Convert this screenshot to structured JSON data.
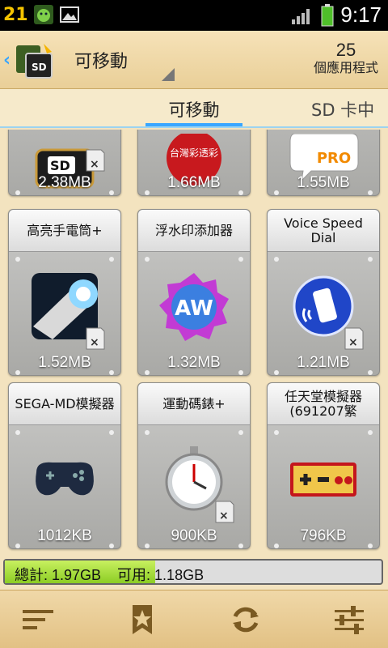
{
  "status_bar": {
    "notification_count": "21",
    "time": "9:17"
  },
  "action_bar": {
    "title": "可移動",
    "app_count": "25",
    "app_count_label": "個應用程式"
  },
  "tabs": [
    {
      "label": "可移動",
      "active": true
    },
    {
      "label": "SD 卡中",
      "active": false
    }
  ],
  "apps": [
    {
      "name": "",
      "size": "2.38MB",
      "icon": "sd-card-app-icon"
    },
    {
      "name": "",
      "size": "1.66MB",
      "icon": "taiwan-lottery-icon",
      "icon_text": "台灣彩透彩"
    },
    {
      "name": "",
      "size": "1.55MB",
      "icon": "pro-speech-bubble-icon",
      "icon_text": "PRO"
    },
    {
      "name": "高亮手電筒+",
      "size": "1.52MB",
      "icon": "flashlight-icon"
    },
    {
      "name": "浮水印添加器",
      "size": "1.32MB",
      "icon": "watermark-aw-icon",
      "icon_text": "AW"
    },
    {
      "name": "Voice Speed Dial",
      "size": "1.21MB",
      "icon": "voice-dial-icon"
    },
    {
      "name": "SEGA-MD模擬器",
      "size": "1012KB",
      "icon": "gamepad-icon"
    },
    {
      "name": "運動碼錶+",
      "size": "900KB",
      "icon": "stopwatch-icon"
    },
    {
      "name": "任天堂模擬器(691207繁",
      "size": "796KB",
      "icon": "famicom-controller-icon"
    }
  ],
  "storage": {
    "text": "總計: 1.97GB    可用: 1.18GB",
    "used_fraction": 0.4
  },
  "bottom_bar": {
    "buttons": [
      "menu-icon",
      "bookmark-icon",
      "refresh-icon",
      "settings-sliders-icon"
    ]
  },
  "colors": {
    "accent": "#39a6ff",
    "storage_fill": "#9ed82e",
    "background": "#f3e3bf"
  }
}
